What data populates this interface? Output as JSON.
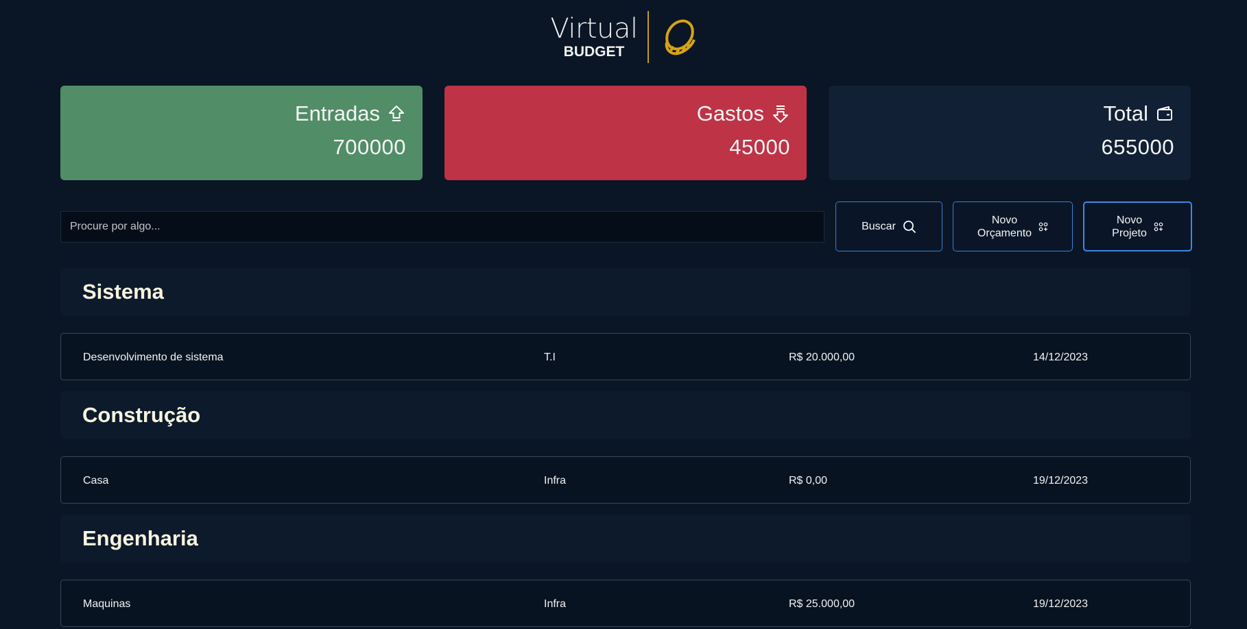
{
  "logo": {
    "main": "Virtual",
    "sub": "BUDGET",
    "icon": "coin-icon",
    "accent": "#c99b10"
  },
  "cards": {
    "income": {
      "title": "Entradas",
      "value": "700000",
      "icon": "arrow-up-icon",
      "color": "#518d67"
    },
    "expense": {
      "title": "Gastos",
      "value": "45000",
      "icon": "arrow-down-icon",
      "color": "#be3346"
    },
    "total": {
      "title": "Total",
      "value": "655000",
      "icon": "wallet-icon",
      "color": "#112034"
    }
  },
  "search": {
    "placeholder": "Procure por algo...",
    "value": ""
  },
  "buttons": {
    "search": {
      "label": "Buscar",
      "icon": "search-icon"
    },
    "new_budget": {
      "line1": "Novo",
      "line2": "Orçamento",
      "icon": "add-grid-icon"
    },
    "new_project": {
      "line1": "Novo",
      "line2": "Projeto",
      "icon": "add-grid-icon"
    },
    "accent": "#3a7fd8"
  },
  "groups": [
    {
      "title": "Sistema",
      "items": [
        {
          "name": "Desenvolvimento de sistema",
          "category": "T.I",
          "value": "R$ 20.000,00",
          "date": "14/12/2023"
        }
      ]
    },
    {
      "title": "Construção",
      "items": [
        {
          "name": "Casa",
          "category": "Infra",
          "value": "R$ 0,00",
          "date": "19/12/2023"
        }
      ]
    },
    {
      "title": "Engenharia",
      "items": [
        {
          "name": "Maquinas",
          "category": "Infra",
          "value": "R$ 25.000,00",
          "date": "19/12/2023"
        }
      ]
    }
  ]
}
